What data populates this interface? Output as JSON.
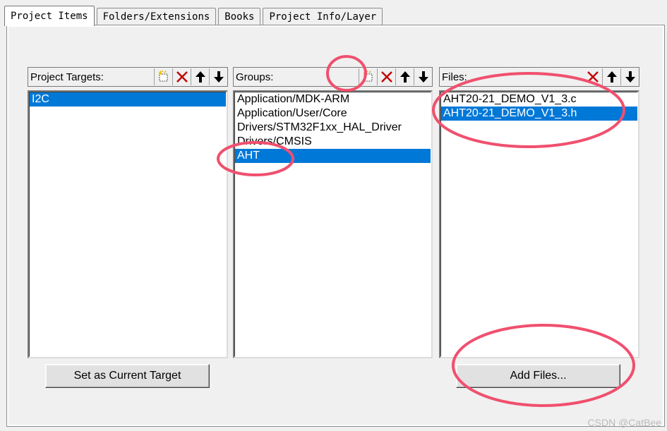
{
  "tabs": [
    "Project Items",
    "Folders/Extensions",
    "Books",
    "Project Info/Layer"
  ],
  "targets": {
    "label": "Project Targets:",
    "items": [
      "I2C"
    ],
    "selected_index": 0
  },
  "groups": {
    "label": "Groups:",
    "items": [
      "Application/MDK-ARM",
      "Application/User/Core",
      "Drivers/STM32F1xx_HAL_Driver",
      "Drivers/CMSIS",
      "AHT"
    ],
    "selected_index": 4
  },
  "files": {
    "label": "Files:",
    "items": [
      "AHT20-21_DEMO_V1_3.c",
      "AHT20-21_DEMO_V1_3.h"
    ],
    "selected_index": 1
  },
  "buttons": {
    "set_current_target": "Set as Current Target",
    "add_files": "Add Files..."
  },
  "icons": {
    "new": "new-item-icon",
    "delete": "delete-icon",
    "move_up": "arrow-up-icon",
    "move_down": "arrow-down-icon"
  },
  "colors": {
    "selection": "#0078d7",
    "annotation": "#f0506e",
    "delete_red": "#c00000"
  },
  "watermark": "CSDN @CatBee"
}
